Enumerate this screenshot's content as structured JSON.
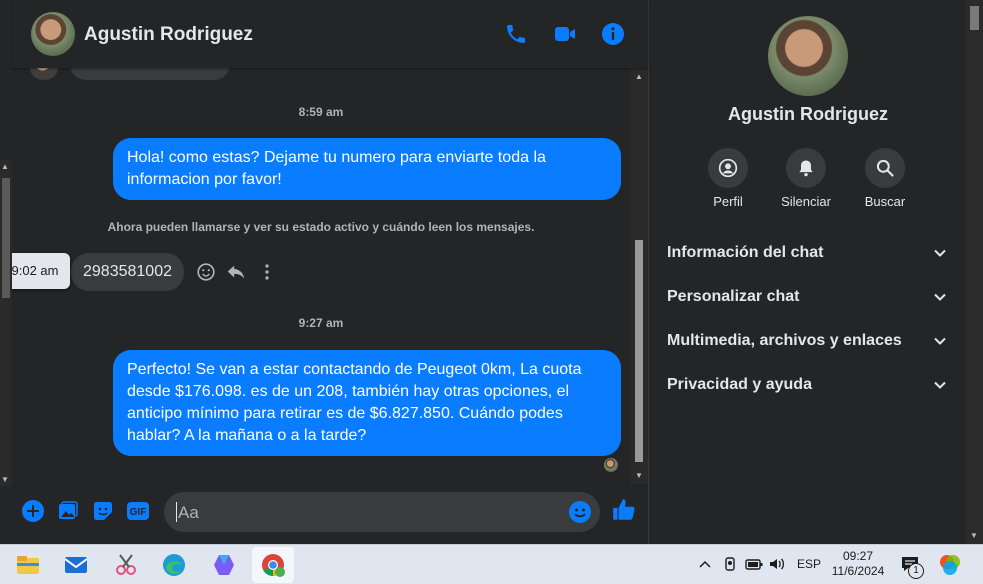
{
  "header": {
    "contact_name": "Agustin Rodriguez",
    "icons": [
      "phone-icon",
      "video-icon",
      "info-icon"
    ]
  },
  "messages": {
    "timestamp_1": "8:59 am",
    "outgoing_1": "Hola! como estas? Dejame tu numero para enviarte toda la informacion por favor!",
    "system_note": "Ahora pueden llamarse y ver su estado activo y cuándo leen los mensajes.",
    "incoming_1": "2983581002",
    "tooltip_time": "9:02 am",
    "timestamp_2": "9:27 am",
    "outgoing_2": "Perfecto!  Se van a estar contactando de Peugeot 0km, La cuota desde $176.098. es de un 208, también hay otras opciones, el anticipo mínimo para retirar es de $6.827.850. Cuándo podes hablar? A la mañana o a la tarde?"
  },
  "composer": {
    "placeholder": "Aa",
    "gif_label": "GIF"
  },
  "panel": {
    "contact_name": "Agustin Rodriguez",
    "actions": [
      {
        "label": "Perfil",
        "icon": "profile-icon"
      },
      {
        "label": "Silenciar",
        "icon": "bell-icon"
      },
      {
        "label": "Buscar",
        "icon": "search-icon"
      }
    ],
    "sections": [
      "Información del chat",
      "Personalizar chat",
      "Multimedia, archivos y enlaces",
      "Privacidad y ayuda"
    ]
  },
  "taskbar": {
    "language": "ESP",
    "time": "09:27",
    "date": "11/6/2024",
    "notification_count": "1"
  },
  "colors": {
    "accent": "#0a7cff",
    "background": "#242526",
    "bubble_incoming": "#3a3b3c"
  }
}
